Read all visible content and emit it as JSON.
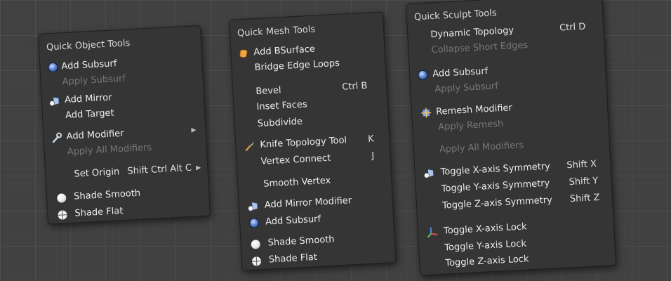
{
  "menus": {
    "object": {
      "title": "Quick Object Tools",
      "add_subsurf": "Add Subsurf",
      "apply_subsurf": "Apply Subsurf",
      "add_mirror": "Add Mirror",
      "add_target": "Add Target",
      "add_modifier": "Add Modifier",
      "apply_all_modifiers": "Apply All Modifiers",
      "set_origin": "Set Origin",
      "set_origin_shortcut": "Shift Ctrl Alt C",
      "shade_smooth": "Shade Smooth",
      "shade_flat": "Shade Flat"
    },
    "mesh": {
      "title": "Quick Mesh Tools",
      "add_bsurface": "Add BSurface",
      "bridge_edge_loops": "Bridge Edge Loops",
      "bevel": "Bevel",
      "bevel_shortcut": "Ctrl B",
      "inset_faces": "Inset Faces",
      "subdivide": "Subdivide",
      "knife_topology_tool": "Knife Topology Tool",
      "knife_shortcut": "K",
      "vertex_connect": "Vertex Connect",
      "vertex_connect_shortcut": "J",
      "smooth_vertex": "Smooth Vertex",
      "add_mirror_modifier": "Add Mirror Modifier",
      "add_subsurf": "Add Subsurf",
      "shade_smooth": "Shade Smooth",
      "shade_flat": "Shade Flat"
    },
    "sculpt": {
      "title": "Quick Sculpt Tools",
      "dynamic_topology": "Dynamic Topology",
      "dynamic_topology_shortcut": "Ctrl D",
      "collapse_short_edges": "Collapse Short Edges",
      "add_subsurf": "Add Subsurf",
      "apply_subsurf": "Apply Subsurf",
      "remesh_modifier": "Remesh Modifier",
      "apply_remesh": "Apply Remesh",
      "apply_all_modifiers": "Apply All Modifiers",
      "toggle_x_symmetry": "Toggle X-axis Symmetry",
      "toggle_x_symmetry_shortcut": "Shift X",
      "toggle_y_symmetry": "Toggle Y-axis Symmetry",
      "toggle_y_symmetry_shortcut": "Shift Y",
      "toggle_z_symmetry": "Toggle Z-axis Symmetry",
      "toggle_z_symmetry_shortcut": "Shift Z",
      "toggle_x_lock": "Toggle X-axis Lock",
      "toggle_y_lock": "Toggle Y-axis Lock",
      "toggle_z_lock": "Toggle Z-axis Lock"
    }
  },
  "icons": {
    "subsurf": "subsurf-icon",
    "mirror": "mirror-icon",
    "wrench": "wrench-icon",
    "smooth": "shade-smooth-icon",
    "flat": "shade-flat-icon",
    "bsurface": "bsurface-icon",
    "knife": "knife-icon",
    "remesh": "remesh-icon",
    "axis": "axis-lock-icon"
  },
  "colors": {
    "background": "#414141",
    "menu_bg": "#353535",
    "text": "#ececec",
    "disabled_text": "#777777",
    "accent_blue": "#5c84d6"
  }
}
